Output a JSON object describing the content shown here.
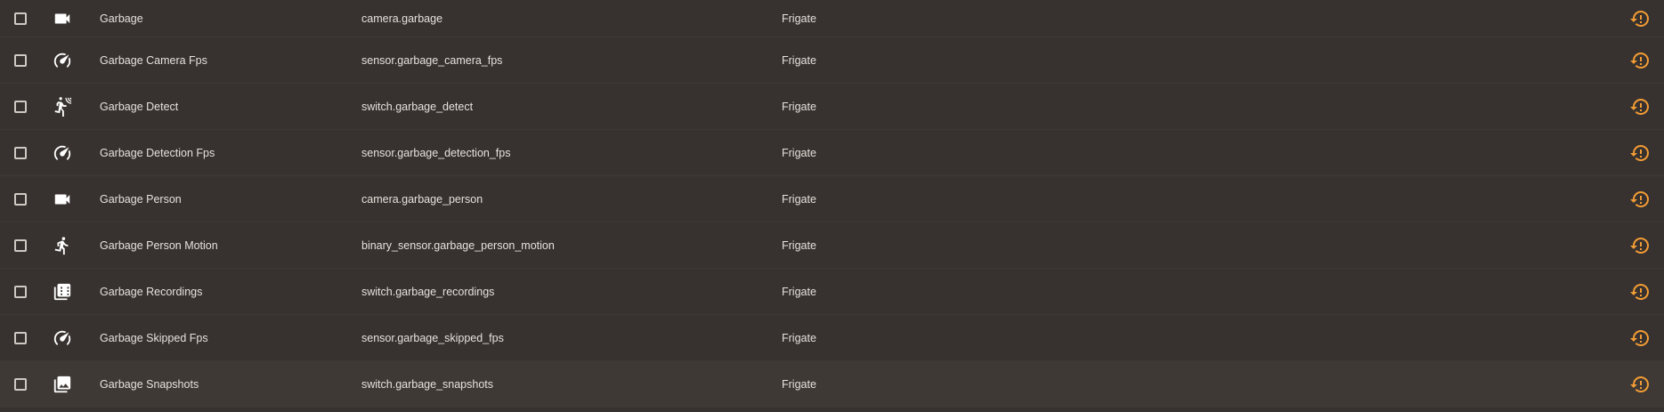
{
  "colors": {
    "background": "#37322f",
    "hover_row": "#3e3935",
    "text": "#e6e1dc",
    "status_icon": "#f39c35"
  },
  "rows": [
    {
      "icon": "video-icon",
      "name": "Garbage",
      "entity_id": "camera.garbage",
      "integration": "Frigate",
      "status_icon": "restore-alert-icon"
    },
    {
      "icon": "speedometer-icon",
      "name": "Garbage Camera Fps",
      "entity_id": "sensor.garbage_camera_fps",
      "integration": "Frigate",
      "status_icon": "restore-alert-icon"
    },
    {
      "icon": "motion-sensor-icon",
      "name": "Garbage Detect",
      "entity_id": "switch.garbage_detect",
      "integration": "Frigate",
      "status_icon": "restore-alert-icon"
    },
    {
      "icon": "speedometer-icon",
      "name": "Garbage Detection Fps",
      "entity_id": "sensor.garbage_detection_fps",
      "integration": "Frigate",
      "status_icon": "restore-alert-icon"
    },
    {
      "icon": "video-icon",
      "name": "Garbage Person",
      "entity_id": "camera.garbage_person",
      "integration": "Frigate",
      "status_icon": "restore-alert-icon"
    },
    {
      "icon": "run-icon",
      "name": "Garbage Person Motion",
      "entity_id": "binary_sensor.garbage_person_motion",
      "integration": "Frigate",
      "status_icon": "restore-alert-icon"
    },
    {
      "icon": "filmstrip-box-multiple-icon",
      "name": "Garbage Recordings",
      "entity_id": "switch.garbage_recordings",
      "integration": "Frigate",
      "status_icon": "restore-alert-icon"
    },
    {
      "icon": "speedometer-icon",
      "name": "Garbage Skipped Fps",
      "entity_id": "sensor.garbage_skipped_fps",
      "integration": "Frigate",
      "status_icon": "restore-alert-icon"
    },
    {
      "icon": "image-multiple-icon",
      "name": "Garbage Snapshots",
      "entity_id": "switch.garbage_snapshots",
      "integration": "Frigate",
      "status_icon": "restore-alert-icon"
    }
  ]
}
